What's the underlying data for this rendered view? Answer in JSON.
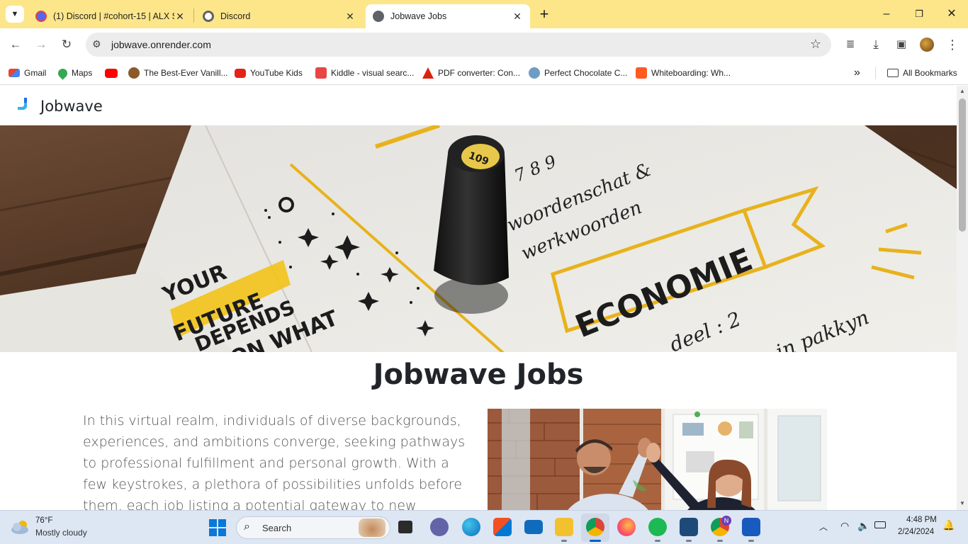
{
  "browser": {
    "tabs": [
      {
        "title": "(1) Discord | #cohort-15 | ALX S",
        "close": "✕"
      },
      {
        "title": "Discord",
        "close": "✕"
      },
      {
        "title": "Jobwave Jobs",
        "close": "✕"
      }
    ],
    "new_tab": "+",
    "address": "jobwave.onrender.com",
    "bookmarks": [
      {
        "label": "Gmail",
        "color": "#ea4335"
      },
      {
        "label": "Maps",
        "color": "#34a853"
      },
      {
        "label": "",
        "color": "#ff0000"
      },
      {
        "label": "The Best-Ever Vanill...",
        "color": "#8b5a2b"
      },
      {
        "label": "YouTube Kids",
        "color": "#e62117"
      },
      {
        "label": "Kiddle - visual searc...",
        "color": "#e84545"
      },
      {
        "label": "PDF converter: Con...",
        "color": "#d9230f"
      },
      {
        "label": "Perfect Chocolate C...",
        "color": "#6d9dc5"
      },
      {
        "label": "Whiteboarding: Wh...",
        "color": "#ff5a1f"
      }
    ],
    "bookmarks_more": "»",
    "all_bookmarks": "All Bookmarks"
  },
  "page": {
    "brand": "Jobwave",
    "title": "Jobwave Jobs",
    "intro": "In this virtual realm, individuals of diverse backgrounds, experiences, and ambitions converge, seeking pathways to professional fulfillment and personal growth. With a few keystrokes, a plethora of possibilities unfolds before them, each job listing a potential gateway to new horizons. Jobwave"
  },
  "taskbar": {
    "weather_temp": "76°F",
    "weather_desc": "Mostly cloudy",
    "search_placeholder": "Search",
    "time": "4:48 PM",
    "date": "2/24/2024",
    "notification_badge": "N"
  }
}
